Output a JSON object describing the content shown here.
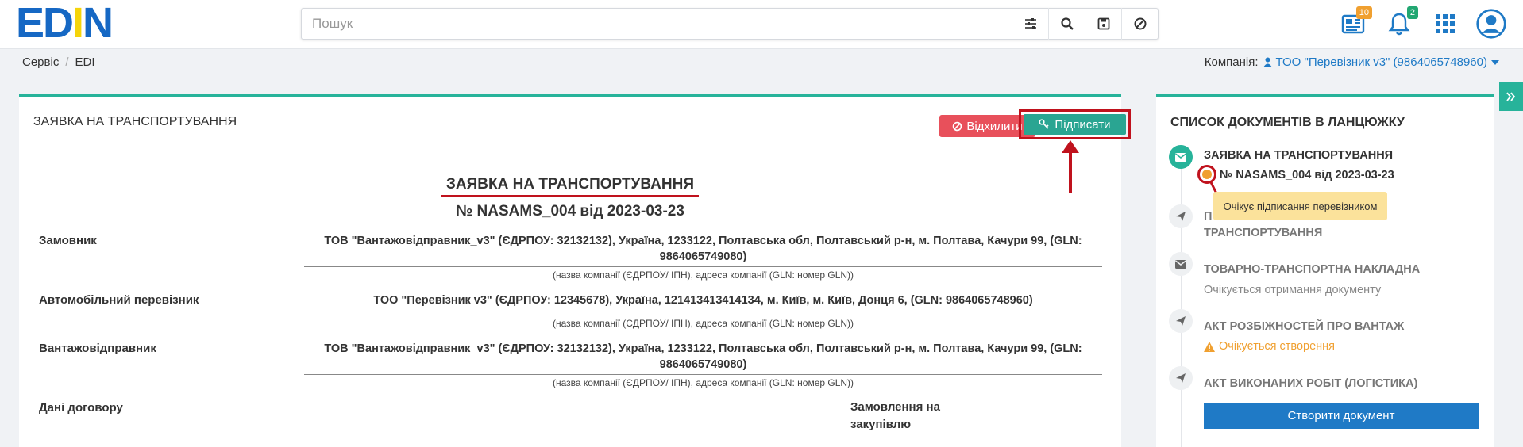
{
  "logo": {
    "part1": "ED",
    "part2": "N",
    "part3": "I"
  },
  "search": {
    "placeholder": "Пошук"
  },
  "badges": {
    "news": "10",
    "notifications": "2"
  },
  "breadcrumb": {
    "items": [
      "Сервіс",
      "EDI"
    ],
    "sep": "/"
  },
  "company": {
    "label": "Компанія:",
    "value": "ТОО \"Перевізник v3\" (9864065748960)"
  },
  "doc": {
    "card_title": "ЗАЯВКА НА ТРАНСПОРТУВАННЯ",
    "reject_label": "Відхилити",
    "sign_label": "Підписати",
    "title": "ЗАЯВКА НА ТРАНСПОРТУВАННЯ",
    "number": "№ NASAMS_004 від 2023-03-23",
    "hint": "(назва компанії (ЄДРПОУ/ ІПН), адреса компанії (GLN: номер GLN))",
    "rows": [
      {
        "label": "Замовник",
        "value": "ТОВ \"Вантажовідправник_v3\" (ЄДРПОУ: 32132132), Україна, 1233122, Полтавська обл, Полтавський р-н, м. Полтава, Качури 99, (GLN: 9864065749080)"
      },
      {
        "label": "Автомобільний перевізник",
        "value": "ТОО \"Перевізник v3\" (ЄДРПОУ: 12345678), Україна, 121413413414134, м. Київ, м. Київ, Донця 6, (GLN: 9864065748960)"
      },
      {
        "label": "Вантажовідправник",
        "value": "ТОВ \"Вантажовідправник_v3\" (ЄДРПОУ: 32132132), Україна, 1233122, Полтавська обл, Полтавський р-н, м. Полтава, Качури 99, (GLN: 9864065749080)"
      }
    ],
    "contract_label": "Дані договору",
    "order_label": "Замовлення на закупівлю"
  },
  "chain": {
    "title": "СПИСОК ДОКУМЕНТІВ В ЛАНЦЮЖКУ",
    "items": [
      {
        "title": "ЗАЯВКА НА ТРАНСПОРТУВАННЯ",
        "number": "№ NASAMS_004 від 2023-03-23"
      },
      {
        "title_part": "П",
        "title_line2": "ТРАНСПОРТУВАННЯ"
      },
      {
        "title": "ТОВАРНО-ТРАНСПОРТНА НАКЛАДНА",
        "status": "Очікується отримання документу"
      },
      {
        "title": "АКТ РОЗБІЖНОСТЕЙ ПРО ВАНТАЖ",
        "status": "Очікується створення"
      },
      {
        "title": "АКТ ВИКОНАНИХ РОБІТ (ЛОГІСТИКА)",
        "button": "Створити документ"
      }
    ],
    "tooltip": "Очікує підписання перевізником"
  }
}
